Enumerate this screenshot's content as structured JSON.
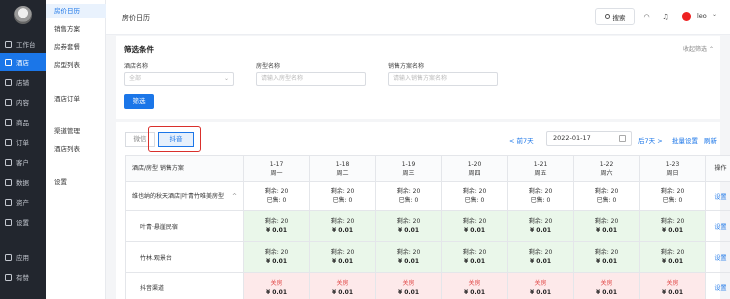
{
  "nav": {
    "items": [
      {
        "label": "工作台",
        "icon": "monitor-icon"
      },
      {
        "label": "酒店",
        "icon": "hotel-icon"
      },
      {
        "label": "店铺",
        "icon": "store-icon"
      },
      {
        "label": "内容",
        "icon": "book-icon"
      },
      {
        "label": "商品",
        "icon": "goods-icon"
      },
      {
        "label": "订单",
        "icon": "order-icon"
      },
      {
        "label": "客户",
        "icon": "user-icon"
      },
      {
        "label": "数据",
        "icon": "chart-icon"
      },
      {
        "label": "资产",
        "icon": "coin-icon"
      },
      {
        "label": "设置",
        "icon": "gear-icon"
      },
      {
        "label": "应用",
        "icon": "apps-icon"
      },
      {
        "label": "有赞",
        "icon": "brand-icon"
      }
    ],
    "active_index": 1
  },
  "menu": {
    "items": [
      "房价日历",
      "销售方案",
      "房券套餐",
      "房型列表",
      "酒店订单",
      "渠道管理",
      "酒店列表",
      "设置"
    ]
  },
  "header": {
    "title": "房价日历",
    "search_label": "搜索",
    "user_name": "leo",
    "chevron": "⌄"
  },
  "filter": {
    "title": "筛选条件",
    "collapse_label": "收起筛选",
    "hotel_label": "酒店名称",
    "hotel_value": "全部",
    "room_label": "房型名称",
    "room_placeholder": "请输入房型名称",
    "plan_label": "销售方案名称",
    "plan_placeholder": "请输入销售方案名称",
    "submit_label": "筛选"
  },
  "channels": {
    "tabs": [
      "微信",
      "抖音"
    ],
    "active": "抖音"
  },
  "date_nav": {
    "prev_label": "< 前7天",
    "date_value": "2022-01-17",
    "next_label": "后7天 >",
    "batch_label": "批量设置",
    "refresh_label": "刷新"
  },
  "table": {
    "name_header": "酒店/房型 销售方案",
    "op_header": "操作",
    "days": [
      {
        "date": "1-17",
        "weekday": "周一"
      },
      {
        "date": "1-18",
        "weekday": "周二"
      },
      {
        "date": "1-19",
        "weekday": "周三"
      },
      {
        "date": "1-20",
        "weekday": "周四"
      },
      {
        "date": "1-21",
        "weekday": "周五"
      },
      {
        "date": "1-22",
        "weekday": "周六"
      },
      {
        "date": "1-23",
        "weekday": "周日"
      }
    ],
    "rows": [
      {
        "type": "main",
        "name": "维也纳的秋天酒店|叶青竹唯美房型",
        "caret": "^",
        "cells": [
          {
            "l1": "剩余: 20",
            "l2": "已售: 0"
          },
          {
            "l1": "剩余: 20",
            "l2": "已售: 0"
          },
          {
            "l1": "剩余: 20",
            "l2": "已售: 0"
          },
          {
            "l1": "剩余: 20",
            "l2": "已售: 0"
          },
          {
            "l1": "剩余: 20",
            "l2": "已售: 0"
          },
          {
            "l1": "剩余: 20",
            "l2": "已售: 0"
          },
          {
            "l1": "剩余: 20",
            "l2": "已售: 0"
          }
        ],
        "op": "设置"
      },
      {
        "type": "room",
        "name": "叶青·悬崖民宿",
        "cells": [
          {
            "l1": "剩余: 20",
            "l2": "¥ 0.01"
          },
          {
            "l1": "剩余: 20",
            "l2": "¥ 0.01"
          },
          {
            "l1": "剩余: 20",
            "l2": "¥ 0.01"
          },
          {
            "l1": "剩余: 20",
            "l2": "¥ 0.01"
          },
          {
            "l1": "剩余: 20",
            "l2": "¥ 0.01"
          },
          {
            "l1": "剩余: 20",
            "l2": "¥ 0.01"
          },
          {
            "l1": "剩余: 20",
            "l2": "¥ 0.01"
          }
        ],
        "op": "设置"
      },
      {
        "type": "room",
        "name": "竹林.观景台",
        "cells": [
          {
            "l1": "剩余: 20",
            "l2": "¥ 0.01"
          },
          {
            "l1": "剩余: 20",
            "l2": "¥ 0.01"
          },
          {
            "l1": "剩余: 20",
            "l2": "¥ 0.01"
          },
          {
            "l1": "剩余: 20",
            "l2": "¥ 0.01"
          },
          {
            "l1": "剩余: 20",
            "l2": "¥ 0.01"
          },
          {
            "l1": "剩余: 20",
            "l2": "¥ 0.01"
          },
          {
            "l1": "剩余: 20",
            "l2": "¥ 0.01"
          }
        ],
        "op": "设置"
      },
      {
        "type": "chan",
        "name": "抖音渠道",
        "cells": [
          {
            "l1": "关房",
            "l2": "¥ 0.01"
          },
          {
            "l1": "关房",
            "l2": "¥ 0.01"
          },
          {
            "l1": "关房",
            "l2": "¥ 0.01"
          },
          {
            "l1": "关房",
            "l2": "¥ 0.01"
          },
          {
            "l1": "关房",
            "l2": "¥ 0.01"
          },
          {
            "l1": "关房",
            "l2": "¥ 0.01"
          },
          {
            "l1": "关房",
            "l2": "¥ 0.01"
          }
        ],
        "op": "设置"
      }
    ]
  },
  "colors": {
    "primary": "#1b76e8",
    "sidebar": "#22262e",
    "available_bg": "#eaf7ea",
    "closed_bg": "#fde9ea",
    "closed_text": "#e24b4b",
    "highlight": "#d9302c"
  }
}
